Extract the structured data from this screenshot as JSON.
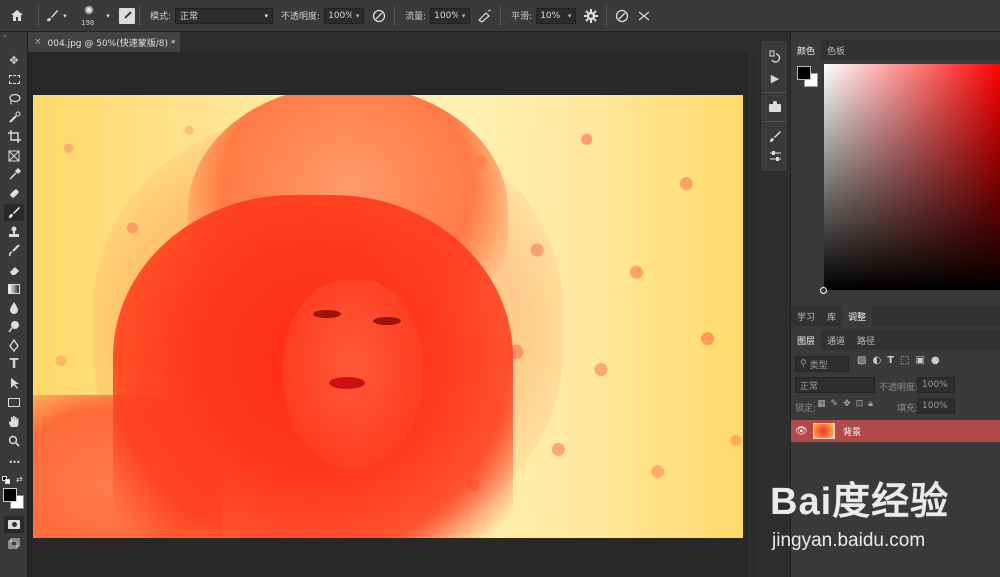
{
  "options_bar": {
    "brush_size": "198",
    "mode_label": "模式:",
    "mode_value": "正常",
    "opacity_label": "不透明度:",
    "opacity_value": "100%",
    "flow_label": "流量:",
    "flow_value": "100%",
    "smoothing_label": "平滑:",
    "smoothing_value": "10%"
  },
  "document_tab": {
    "close": "×",
    "title": "004.jpg @ 50%(快速蒙版/8) *"
  },
  "toolbar": {
    "more": "•••",
    "text_tool": "T"
  },
  "color_panel": {
    "tabs": [
      "颜色",
      "色板"
    ],
    "foreground": "#000000",
    "background": "#ffffff",
    "picker_hue": "#ff0000"
  },
  "learn_panel": {
    "tabs": [
      "学习",
      "库",
      "调整"
    ],
    "active": "调整"
  },
  "layers_panel": {
    "tabs": [
      "图层",
      "通道",
      "路径"
    ],
    "filter_placeholder": "类型",
    "blend_mode": "正常",
    "opacity_label": "不透明度:",
    "opacity_value": "100%",
    "lock_label": "锁定:",
    "fill_label": "填充:",
    "fill_value": "100%",
    "layers": [
      {
        "name": "背景",
        "visible": true
      }
    ]
  },
  "quick_mask_color": "#ff3a1c",
  "watermark": {
    "logo": "Bai度经验",
    "url": "jingyan.baidu.com"
  }
}
